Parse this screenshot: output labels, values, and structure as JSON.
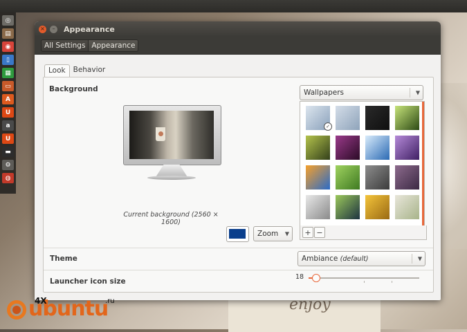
{
  "window": {
    "title": "Appearance",
    "controls": {
      "close": "×",
      "minimize": "–"
    }
  },
  "toolbar": {
    "breadcrumbs": [
      "All Settings",
      "Appearance"
    ]
  },
  "tabs": [
    {
      "label": "Look",
      "active": true
    },
    {
      "label": "Behavior",
      "active": false
    }
  ],
  "background": {
    "section_label": "Background",
    "caption": "Current background (2560 × 1600)",
    "color_swatch": "#0b3f8c",
    "mode_select": {
      "value": "Zoom"
    },
    "source_select": {
      "value": "Wallpapers"
    },
    "gallery": {
      "thumbnails": [
        {
          "name": "blue-glass-flowers",
          "colors": [
            "#dce5ee",
            "#8aa1bb"
          ],
          "selected": true
        },
        {
          "name": "blue-glass-flowers-2",
          "colors": [
            "#d4dde8",
            "#8ea3ba"
          ],
          "selected": false
        },
        {
          "name": "dark-night-sky",
          "colors": [
            "#2a2a2a",
            "#0f0f0f"
          ],
          "selected": false
        },
        {
          "name": "green-leaf",
          "colors": [
            "#c6e37a",
            "#2d4a14"
          ],
          "selected": false
        },
        {
          "name": "green-wheat-field",
          "colors": [
            "#b4c34c",
            "#33401a"
          ],
          "selected": false
        },
        {
          "name": "purple-flower",
          "colors": [
            "#9a3a8a",
            "#2b0b26"
          ],
          "selected": false
        },
        {
          "name": "snowy-mountains",
          "colors": [
            "#d9ecfb",
            "#2b6ab4"
          ],
          "selected": false
        },
        {
          "name": "purple-sunset",
          "colors": [
            "#b58ad8",
            "#402064"
          ],
          "selected": false
        },
        {
          "name": "rainbow-building",
          "colors": [
            "#f6a02b",
            "#2a6bc8"
          ],
          "selected": false
        },
        {
          "name": "green-tree",
          "colors": [
            "#9fd25f",
            "#3f7a22"
          ],
          "selected": false
        },
        {
          "name": "grey-heron",
          "colors": [
            "#8c8c8c",
            "#3c3c3c"
          ],
          "selected": false
        },
        {
          "name": "purple-dusk-bird",
          "colors": [
            "#8c6a8c",
            "#3c2a44"
          ],
          "selected": false
        },
        {
          "name": "grey-sea",
          "colors": [
            "#e8e8e8",
            "#8a8a8a"
          ],
          "selected": false
        },
        {
          "name": "green-flower-dark",
          "colors": [
            "#9bc85b",
            "#1d3340"
          ],
          "selected": false
        },
        {
          "name": "yellow-flower",
          "colors": [
            "#f4c43a",
            "#9a6a14"
          ],
          "selected": false
        },
        {
          "name": "grass-blades",
          "colors": [
            "#e8e6da",
            "#a8b48a"
          ],
          "selected": false
        }
      ],
      "add_label": "+",
      "remove_label": "−"
    }
  },
  "theme": {
    "label": "Theme",
    "value": "Ambiance",
    "suffix": "(default)"
  },
  "launcher": {
    "label": "Launcher icon size",
    "value": "18",
    "min": 16,
    "max": 64,
    "current": 18
  },
  "launcher_bar": {
    "items": [
      {
        "name": "dash-icon",
        "color": "#6e6c67",
        "glyph": "◎"
      },
      {
        "name": "files-icon",
        "color": "#8a6a4a",
        "glyph": "▤"
      },
      {
        "name": "chrome-icon",
        "color": "#d7443a",
        "glyph": "◉"
      },
      {
        "name": "document-icon",
        "color": "#3a78c8",
        "glyph": "▯"
      },
      {
        "name": "spreadsheet-icon",
        "color": "#2f9a3e",
        "glyph": "▦"
      },
      {
        "name": "presentation-icon",
        "color": "#c85a2a",
        "glyph": "▭"
      },
      {
        "name": "software-center-icon",
        "color": "#dd5a1e",
        "glyph": "A"
      },
      {
        "name": "ubuntu-one-icon",
        "color": "#dd4814",
        "glyph": "U"
      },
      {
        "name": "amazon-icon",
        "color": "#4a4a4a",
        "glyph": "a"
      },
      {
        "name": "ubuntu-one-music-icon",
        "color": "#dd4814",
        "glyph": "U"
      },
      {
        "name": "terminal-icon",
        "color": "#2d2d2d",
        "glyph": "▬"
      },
      {
        "name": "settings-icon",
        "color": "#5e5c58",
        "glyph": "⚙"
      },
      {
        "name": "appearance-settings-icon",
        "color": "#c23a2a",
        "glyph": "◍"
      }
    ]
  },
  "watermark": {
    "brand": "ubuntu",
    "prefix": "4X",
    "suffix": ".ru"
  }
}
